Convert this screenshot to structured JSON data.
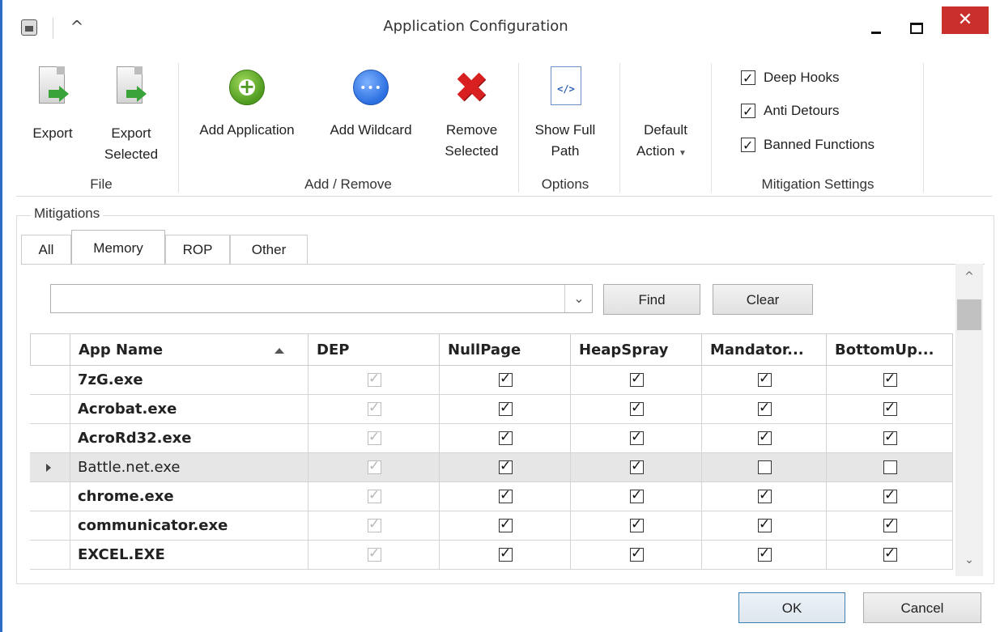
{
  "window": {
    "title": "Application Configuration",
    "accent_color": "#2b6cc4",
    "close_color": "#c9302c"
  },
  "ribbon": {
    "file": {
      "group_label": "File",
      "export_label": "Export",
      "export_selected_line1": "Export",
      "export_selected_line2": "Selected"
    },
    "add_remove": {
      "group_label": "Add / Remove",
      "add_application_label": "Add Application",
      "add_wildcard_label": "Add Wildcard",
      "remove_selected_line1": "Remove",
      "remove_selected_line2": "Selected"
    },
    "options": {
      "group_label": "Options",
      "show_full_path_line1": "Show Full",
      "show_full_path_line2": "Path"
    },
    "default_action": {
      "line1": "Default",
      "line2": "Action"
    },
    "mitigation_settings": {
      "group_label": "Mitigation Settings",
      "deep_hooks": "Deep Hooks",
      "anti_detours": "Anti Detours",
      "banned_functions": "Banned Functions",
      "deep_hooks_checked": true,
      "anti_detours_checked": true,
      "banned_functions_checked": true
    }
  },
  "mitigations": {
    "legend": "Mitigations",
    "tabs": [
      {
        "label": "All",
        "active": false
      },
      {
        "label": "Memory",
        "active": true
      },
      {
        "label": "ROP",
        "active": false
      },
      {
        "label": "Other",
        "active": false
      }
    ],
    "search": {
      "value": "",
      "find_label": "Find",
      "clear_label": "Clear"
    },
    "columns": [
      "App Name",
      "DEP",
      "NullPage",
      "HeapSpray",
      "Mandator...",
      "BottomUp..."
    ],
    "rows": [
      {
        "name": "7zG.exe",
        "bold": true,
        "selected": false,
        "dep": true,
        "nullpage": true,
        "heapspray": true,
        "mandatory": true,
        "bottomup": true
      },
      {
        "name": "Acrobat.exe",
        "bold": true,
        "selected": false,
        "dep": true,
        "nullpage": true,
        "heapspray": true,
        "mandatory": true,
        "bottomup": true
      },
      {
        "name": "AcroRd32.exe",
        "bold": true,
        "selected": false,
        "dep": true,
        "nullpage": true,
        "heapspray": true,
        "mandatory": true,
        "bottomup": true
      },
      {
        "name": "Battle.net.exe",
        "bold": false,
        "selected": true,
        "dep": true,
        "nullpage": true,
        "heapspray": true,
        "mandatory": false,
        "bottomup": false
      },
      {
        "name": "chrome.exe",
        "bold": true,
        "selected": false,
        "dep": true,
        "nullpage": true,
        "heapspray": true,
        "mandatory": true,
        "bottomup": true
      },
      {
        "name": "communicator.exe",
        "bold": true,
        "selected": false,
        "dep": true,
        "nullpage": true,
        "heapspray": true,
        "mandatory": true,
        "bottomup": true
      },
      {
        "name": "EXCEL.EXE",
        "bold": true,
        "selected": false,
        "dep": true,
        "nullpage": true,
        "heapspray": true,
        "mandatory": true,
        "bottomup": true
      }
    ]
  },
  "footer": {
    "ok_label": "OK",
    "cancel_label": "Cancel"
  }
}
